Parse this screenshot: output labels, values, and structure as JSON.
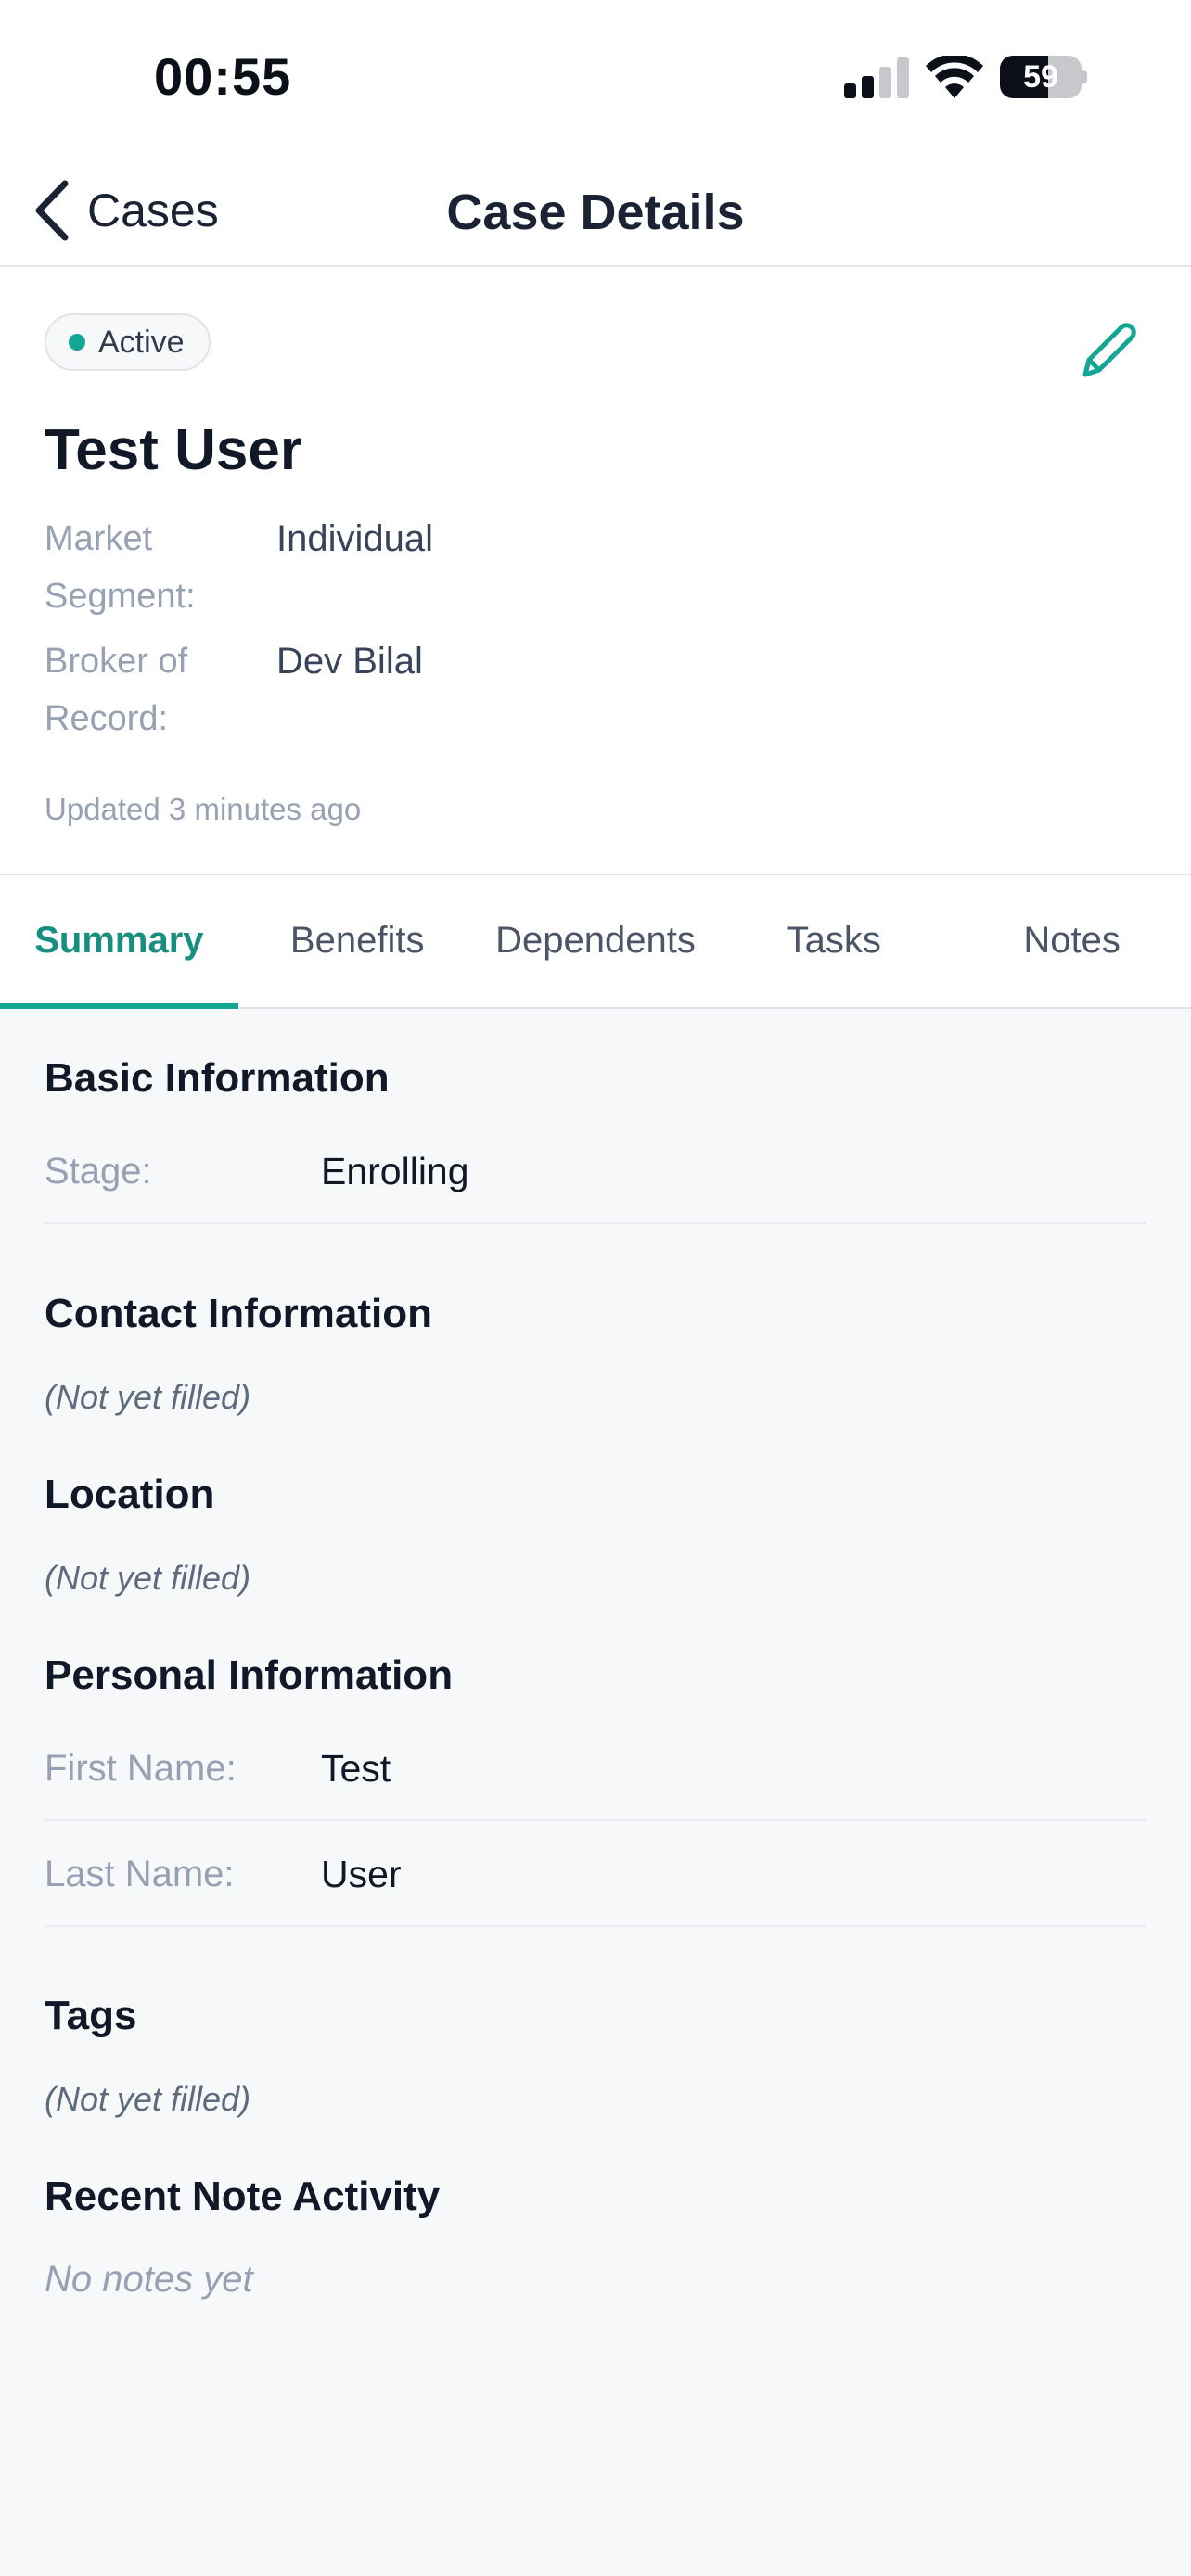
{
  "status_bar": {
    "time": "00:55",
    "battery_level": "59",
    "battery_fraction": 0.59,
    "icons": [
      "signal-icon",
      "wifi-icon",
      "battery-icon"
    ]
  },
  "nav": {
    "back_label": "Cases",
    "back_icon": "chevron-left-icon",
    "title": "Case Details"
  },
  "case": {
    "status": "Active",
    "status_color": "#15a593",
    "name": "Test User",
    "edit_icon": "pencil-icon",
    "meta": [
      {
        "label_line1": "Market",
        "label_line2": "Segment:",
        "value": "Individual"
      },
      {
        "label_line1": "Broker of",
        "label_line2": "Record:",
        "value": "Dev Bilal"
      }
    ],
    "updated": "Updated 3 minutes ago"
  },
  "tabs": [
    {
      "label": "Summary",
      "active": true
    },
    {
      "label": "Benefits",
      "active": false
    },
    {
      "label": "Dependents",
      "active": false
    },
    {
      "label": "Tasks",
      "active": false
    },
    {
      "label": "Notes",
      "active": false
    }
  ],
  "summary": {
    "basic_information": {
      "title": "Basic Information",
      "fields": [
        {
          "label": "Stage:",
          "value": "Enrolling"
        }
      ]
    },
    "contact_information": {
      "title": "Contact Information",
      "empty": "(Not yet filled)"
    },
    "location": {
      "title": "Location",
      "empty": "(Not yet filled)"
    },
    "personal_information": {
      "title": "Personal Information",
      "fields": [
        {
          "label": "First Name:",
          "value": "Test"
        },
        {
          "label": "Last Name:",
          "value": "User"
        }
      ]
    },
    "tags": {
      "title": "Tags",
      "empty": "(Not yet filled)"
    },
    "recent_note_activity": {
      "title": "Recent Note Activity",
      "empty": "No notes yet"
    }
  },
  "colors": {
    "accent": "#15a593",
    "accent_text": "#168f80",
    "background": "#f7f8fa",
    "card": "#ffffff"
  }
}
